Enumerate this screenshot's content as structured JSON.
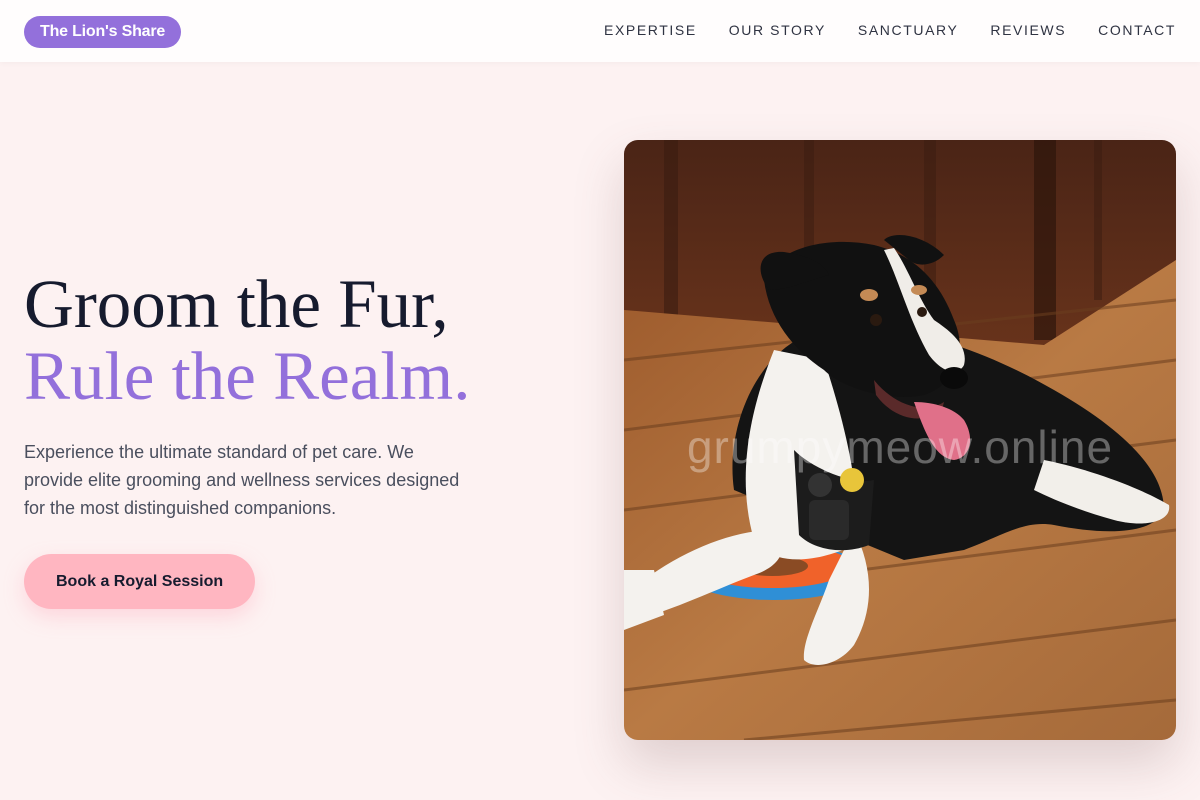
{
  "brand": {
    "name": "The Lion's Share",
    "accent": "#9370db",
    "cta_color": "#ffb6c1",
    "background": "#fdf2f2"
  },
  "nav": {
    "links": [
      "EXPERTISE",
      "OUR STORY",
      "SANCTUARY",
      "REVIEWS",
      "CONTACT"
    ]
  },
  "hero": {
    "headline_line1": "Groom the Fur,",
    "headline_line2": "Rule the Realm.",
    "description": "Experience the ultimate standard of pet care. We provide elite grooming and wellness services designed for the most distinguished companions.",
    "cta_label": "Book a Royal Session",
    "watermark": "grumpymeow.online"
  }
}
